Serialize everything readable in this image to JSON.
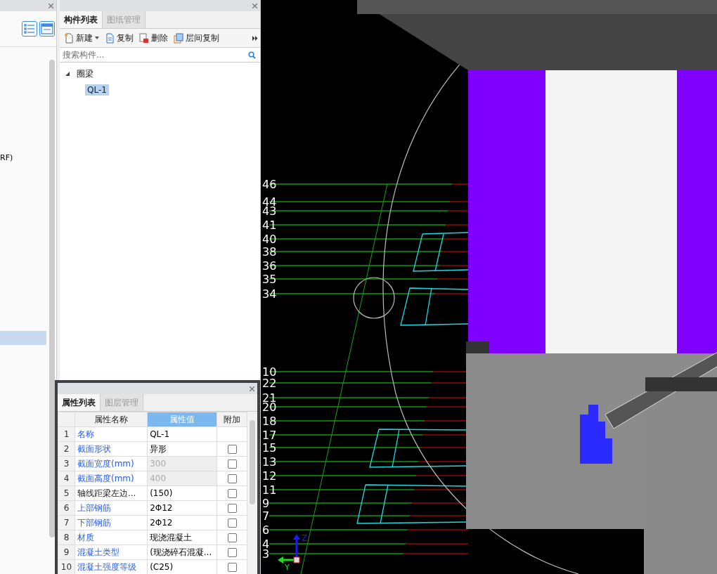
{
  "left_panel": {
    "rows": [
      {
        "label": "RF)",
        "selected": false
      },
      {
        "selected": true
      }
    ]
  },
  "component_panel": {
    "tabs": [
      {
        "label": "构件列表",
        "selected": true
      },
      {
        "label": "图纸管理",
        "selected": false
      }
    ],
    "toolbar": [
      {
        "kind": "new",
        "label": "新建"
      },
      {
        "kind": "copy",
        "label": "复制"
      },
      {
        "kind": "delete",
        "label": "删除"
      },
      {
        "kind": "floor-copy",
        "label": "层间复制"
      }
    ],
    "search": {
      "placeholder": "搜索构件..."
    },
    "tree": [
      {
        "label": "圈梁",
        "expanded": true,
        "children": [
          {
            "label": "QL-1",
            "selected": true
          }
        ]
      }
    ]
  },
  "property_panel": {
    "tabs": [
      {
        "label": "属性列表",
        "selected": true
      },
      {
        "label": "图层管理",
        "selected": false
      }
    ],
    "columns": [
      {
        "label": "属性名称",
        "selected": false
      },
      {
        "label": "属性值",
        "selected": true
      },
      {
        "label": "附加",
        "selected": false
      }
    ],
    "rows": [
      {
        "index": "1",
        "name": "名称",
        "value": "QL-1",
        "public": true,
        "disabled": false
      },
      {
        "index": "2",
        "name": "截面形状",
        "value": "异形",
        "public": true,
        "disabled": false,
        "checked": false
      },
      {
        "index": "3",
        "name": "截面宽度(mm)",
        "value": "300",
        "public": true,
        "disabled": true,
        "checked": false
      },
      {
        "index": "4",
        "name": "截面高度(mm)",
        "value": "400",
        "public": true,
        "disabled": true,
        "checked": false
      },
      {
        "index": "5",
        "name": "轴线距梁左边...",
        "value": "(150)",
        "public": false,
        "disabled": false,
        "checked": false
      },
      {
        "index": "6",
        "name": "上部钢筋",
        "value": "2Φ12",
        "public": true,
        "disabled": false,
        "checked": false
      },
      {
        "index": "7",
        "name": "下部钢筋",
        "value": "2Φ12",
        "public": true,
        "disabled": false,
        "checked": false
      },
      {
        "index": "8",
        "name": "材质",
        "value": "现浇混凝土",
        "public": true,
        "disabled": false,
        "checked": false
      },
      {
        "index": "9",
        "name": "混凝土类型",
        "value": "(现浇碎石混凝...",
        "public": true,
        "disabled": false,
        "checked": false
      },
      {
        "index": "10",
        "name": "混凝土强度等级",
        "value": "(C25)",
        "public": true,
        "disabled": false,
        "checked": false
      }
    ]
  },
  "viewport": {
    "axis_labels": [
      "46",
      "44",
      "43",
      "41",
      "40",
      "38",
      "36",
      "35",
      "34",
      "10",
      "22",
      "21",
      "20",
      "18",
      "17",
      "15",
      "13",
      "12",
      "11",
      "9",
      "7",
      "6",
      "4",
      "3"
    ],
    "axis_z": "Z",
    "axis_y": "Y"
  }
}
